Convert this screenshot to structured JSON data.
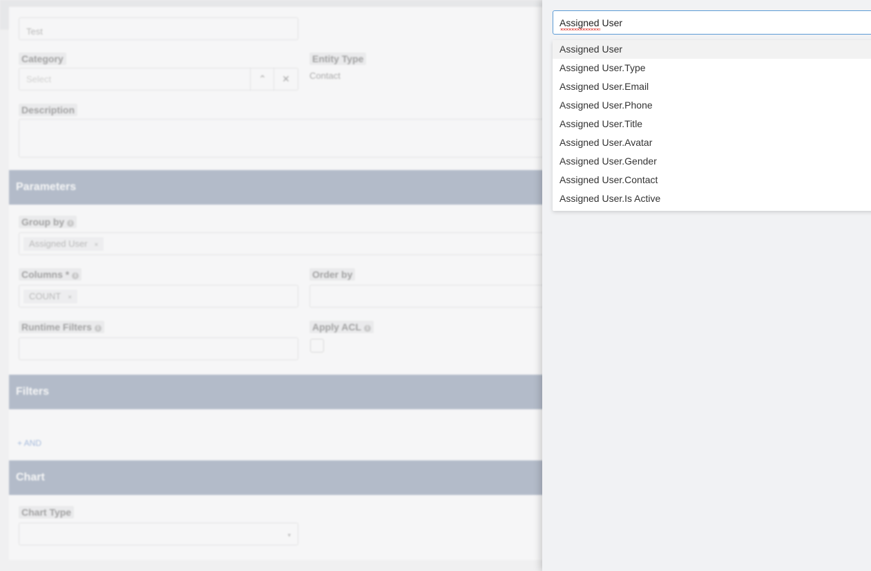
{
  "form": {
    "name_value": "Test",
    "category": {
      "label": "Category",
      "placeholder": "Select"
    },
    "entity_type": {
      "label": "Entity Type",
      "value": "Contact"
    },
    "description": {
      "label": "Description"
    },
    "sections": {
      "parameters": "Parameters",
      "filters": "Filters",
      "chart": "Chart"
    },
    "group_by": {
      "label": "Group by",
      "chip": "Assigned User"
    },
    "columns": {
      "label": "Columns *",
      "chip": "COUNT"
    },
    "order_by": {
      "label": "Order by"
    },
    "runtime_filters": {
      "label": "Runtime Filters"
    },
    "apply_acl": {
      "label": "Apply ACL"
    },
    "add_and": "+ AND",
    "chart_type": {
      "label": "Chart Type"
    }
  },
  "picker": {
    "search_value": "Assigned User",
    "options": [
      "Assigned User",
      "Assigned User.Type",
      "Assigned User.Email",
      "Assigned User.Phone",
      "Assigned User.Title",
      "Assigned User.Avatar",
      "Assigned User.Gender",
      "Assigned User.Contact",
      "Assigned User.Is Active"
    ]
  }
}
